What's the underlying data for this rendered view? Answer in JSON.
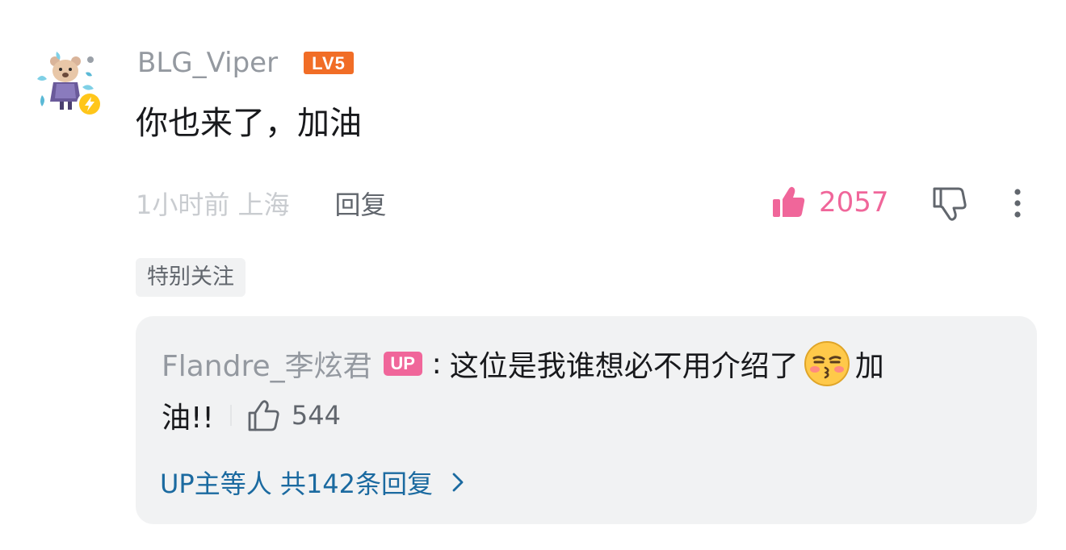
{
  "comment": {
    "username": "BLG_Viper",
    "level_badge": "LV5",
    "text": "你也来了，加油",
    "time_location": "1小时前 上海",
    "reply_label": "回复",
    "like_count": "2057",
    "tag": "特别关注"
  },
  "reply": {
    "username": "Flandre_李炫君",
    "up_badge": "UP",
    "colon": ":",
    "text_line1": "这位是我谁想必不用介绍了",
    "text_line1_after_emoji": "加",
    "text_line2": "油!!",
    "like_count": "544",
    "more_replies": "UP主等人 共142条回复"
  },
  "icons": {
    "avatar": "user-avatar",
    "verified": "lightning-icon",
    "like": "thumbs-up-filled-icon",
    "dislike": "thumbs-down-icon",
    "more": "more-vertical-icon",
    "reply_like": "thumbs-up-outline-icon",
    "emoji": "kiss-face-emoji",
    "chevron": "chevron-right-icon"
  },
  "colors": {
    "accent_pink": "#f0669a",
    "level_orange": "#f16d26",
    "link_blue": "#1b6aa0",
    "text_primary": "#18191c",
    "text_secondary": "#9499a0",
    "text_tertiary": "#c9ccd0",
    "verified_yellow": "#ffc61a"
  }
}
